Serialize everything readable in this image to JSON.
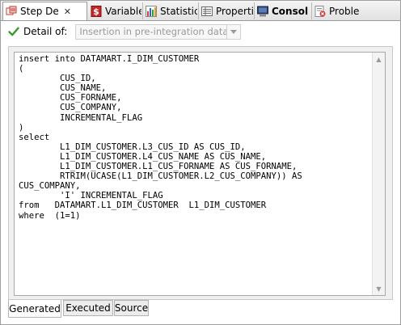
{
  "tabs": [
    {
      "label": "Step De",
      "icon": "step-detail-icon",
      "selected": true,
      "close": "✕"
    },
    {
      "label": "Variable",
      "icon": "dollar-icon"
    },
    {
      "label": "Statistic",
      "icon": "bar-chart-icon"
    },
    {
      "label": "Properti",
      "icon": "properties-icon"
    },
    {
      "label": "Consol",
      "icon": "console-icon",
      "bold": true
    },
    {
      "label": "Proble",
      "icon": "problems-icon"
    }
  ],
  "toolbar": {
    "detail_label": "Detail of:",
    "combo_value": "Insertion in pre-integration data"
  },
  "editor": {
    "code": "insert into DATAMART.I_DIM_CUSTOMER\n(\n        CUS_ID,\n        CUS_NAME,\n        CUS_FORNAME,\n        CUS_COMPANY,\n        INCREMENTAL_FLAG\n)\nselect\n        L1_DIM_CUSTOMER.L3_CUS_ID AS CUS_ID,\n        L1_DIM_CUSTOMER.L4_CUS_NAME AS CUS_NAME,\n        L1_DIM_CUSTOMER.L1_CUS_FORNAME AS CUS_FORNAME,\n        RTRIM(UCASE(L1_DIM_CUSTOMER.L2_CUS_COMPANY)) AS\nCUS_COMPANY,\n        'I' INCREMENTAL_FLAG\nfrom   DATAMART.L1_DIM_CUSTOMER  L1_DIM_CUSTOMER\nwhere  (1=1)"
  },
  "subtabs": [
    {
      "label": "Generated",
      "selected": true
    },
    {
      "label": "Executed"
    },
    {
      "label": "Source"
    }
  ],
  "colors": {
    "check_green": "#3a9a2a",
    "dollar_red": "#c62828"
  }
}
